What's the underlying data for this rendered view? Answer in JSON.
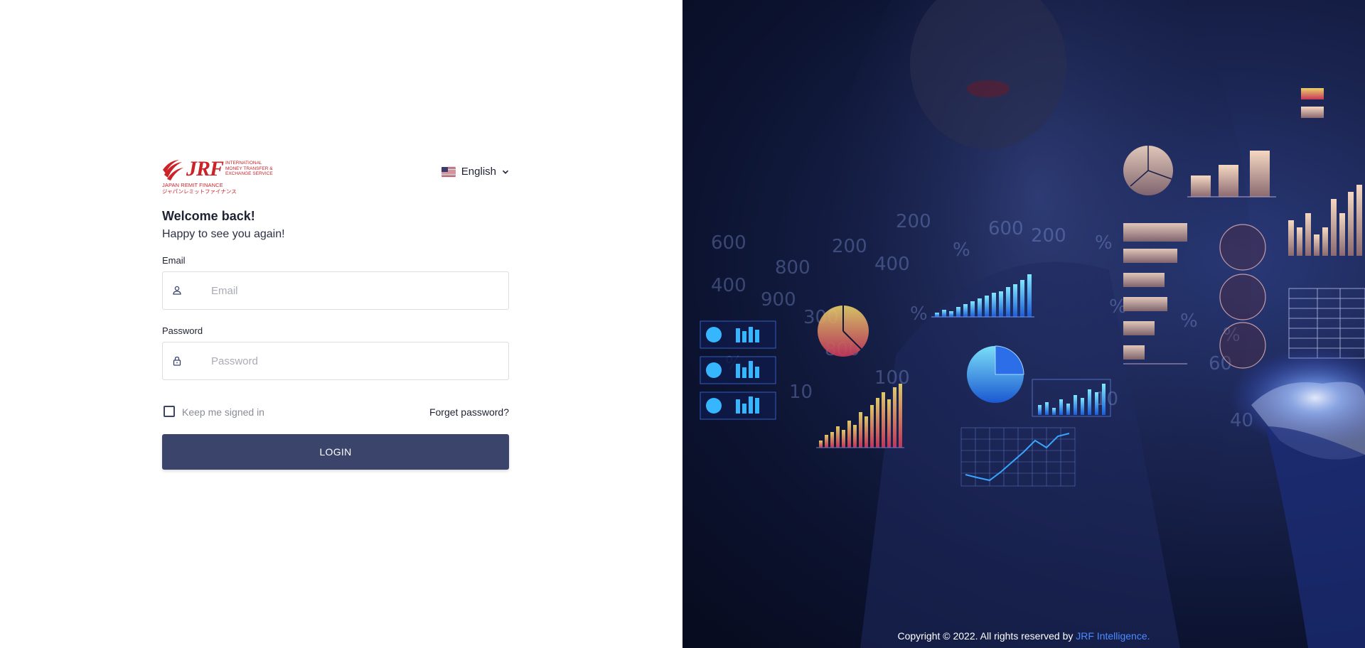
{
  "logo": {
    "brand": "JRF",
    "tagline": "International Money Transfer & Exchange Service",
    "subtitle": "Japan Remit Finance",
    "subtitle_jp": "ジャパンレミットファイナンス"
  },
  "language": {
    "label": "English",
    "flag": "us-flag-icon"
  },
  "welcome": {
    "title": "Welcome back!",
    "subtitle": "Happy to see you again!"
  },
  "email": {
    "label": "Email",
    "placeholder": "Email",
    "value": ""
  },
  "password": {
    "label": "Password",
    "placeholder": "Password",
    "value": ""
  },
  "remember": {
    "label": "Keep me signed in",
    "checked": false
  },
  "forgot": {
    "label": "Forget password?"
  },
  "login": {
    "label": "LOGIN"
  },
  "footer": {
    "text": "Copyright © 2022. All rights reserved by ",
    "link": "JRF Intelligence."
  },
  "colors": {
    "brand_red": "#cc2229",
    "button": "#3b446b",
    "link": "#4a8bff"
  }
}
